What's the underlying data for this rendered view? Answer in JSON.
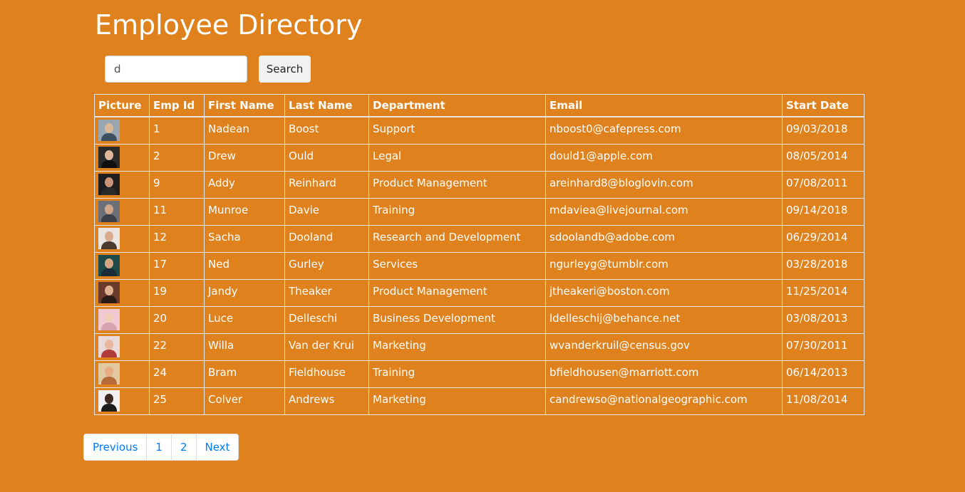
{
  "page": {
    "title": "Employee Directory"
  },
  "search": {
    "value": "d",
    "button_label": "Search"
  },
  "table": {
    "headers": [
      "Picture",
      "Emp Id",
      "First Name",
      "Last Name",
      "Department",
      "Email",
      "Start Date"
    ],
    "rows": [
      {
        "id": "1",
        "first": "Nadean",
        "last": "Boost",
        "dept": "Support",
        "email": "nboost0@cafepress.com",
        "start": "09/03/2018",
        "bg": "#9aa7b3",
        "skin": "#d9b89a",
        "shirt": "#3e4f5f"
      },
      {
        "id": "2",
        "first": "Drew",
        "last": "Ould",
        "dept": "Legal",
        "email": "dould1@apple.com",
        "start": "08/05/2014",
        "bg": "#2b2b2b",
        "skin": "#e0b79b",
        "shirt": "#111111"
      },
      {
        "id": "9",
        "first": "Addy",
        "last": "Reinhard",
        "dept": "Product Management",
        "email": "areinhard8@bloglovin.com",
        "start": "07/08/2011",
        "bg": "#1e1e1e",
        "skin": "#c89677",
        "shirt": "#2a2a2a"
      },
      {
        "id": "11",
        "first": "Munroe",
        "last": "Davie",
        "dept": "Training",
        "email": "mdaviea@livejournal.com",
        "start": "09/14/2018",
        "bg": "#6b6f78",
        "skin": "#d2a587",
        "shirt": "#3d3f46"
      },
      {
        "id": "12",
        "first": "Sacha",
        "last": "Dooland",
        "dept": "Research and Development",
        "email": "sdoolandb@adobe.com",
        "start": "06/29/2014",
        "bg": "#e9e4df",
        "skin": "#d8ab8c",
        "shirt": "#4b3a30"
      },
      {
        "id": "17",
        "first": "Ned",
        "last": "Gurley",
        "dept": "Services",
        "email": "ngurleyg@tumblr.com",
        "start": "03/28/2018",
        "bg": "#1f4a4a",
        "skin": "#d7a784",
        "shirt": "#1b2b3a"
      },
      {
        "id": "19",
        "first": "Jandy",
        "last": "Theaker",
        "dept": "Product Management",
        "email": "jtheakeri@boston.com",
        "start": "11/25/2014",
        "bg": "#6a3b2b",
        "skin": "#e1b090",
        "shirt": "#2b1b16"
      },
      {
        "id": "20",
        "first": "Luce",
        "last": "Delleschi",
        "dept": "Business Development",
        "email": "ldelleschij@behance.net",
        "start": "03/08/2013",
        "bg": "#f1c9d4",
        "skin": "#f0cdb8",
        "shirt": "#d6a4b0"
      },
      {
        "id": "22",
        "first": "Willa",
        "last": "Van der Krui",
        "dept": "Marketing",
        "email": "wvanderkruil@census.gov",
        "start": "07/30/2011",
        "bg": "#e8dada",
        "skin": "#e9b79f",
        "shirt": "#b23b3b"
      },
      {
        "id": "24",
        "first": "Bram",
        "last": "Fieldhouse",
        "dept": "Training",
        "email": "bfieldhousen@marriott.com",
        "start": "06/14/2013",
        "bg": "#e0c9a0",
        "skin": "#e7ac84",
        "shirt": "#b76a3a"
      },
      {
        "id": "25",
        "first": "Colver",
        "last": "Andrews",
        "dept": "Marketing",
        "email": "candrewso@nationalgeographic.com",
        "start": "11/08/2014",
        "bg": "#f0f0f0",
        "skin": "#3c2a22",
        "shirt": "#1c1c1c"
      }
    ]
  },
  "pagination": {
    "previous_label": "Previous",
    "pages": [
      "1",
      "2"
    ],
    "next_label": "Next"
  },
  "colors": {
    "background": "#df821d",
    "link": "#007bff",
    "border": "#e6e6e6"
  }
}
